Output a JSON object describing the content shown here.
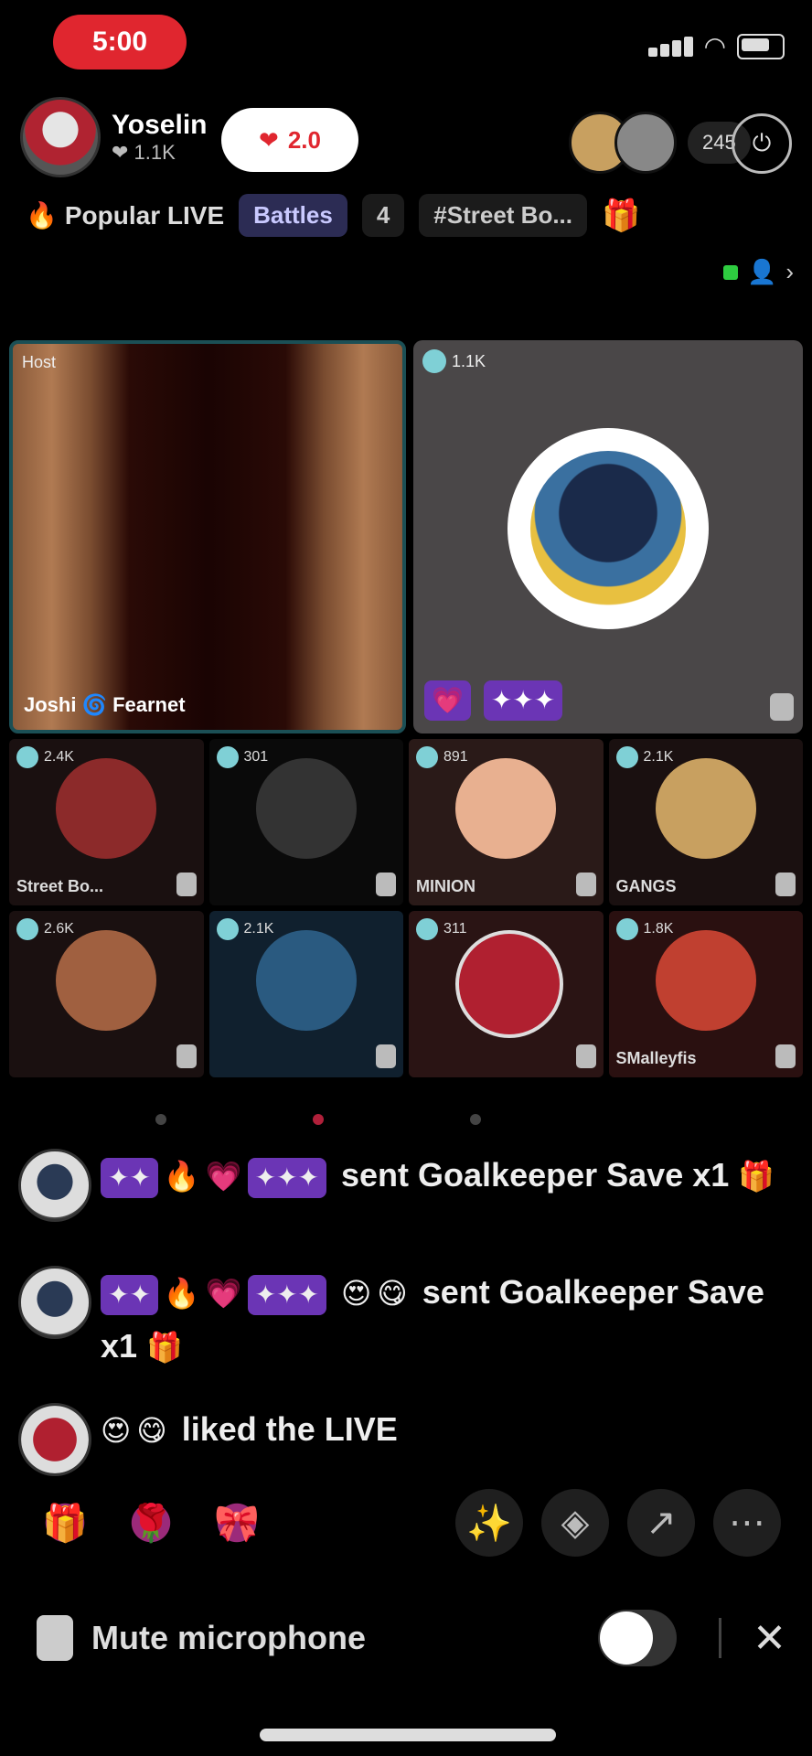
{
  "status_bar": {
    "time": "5:00"
  },
  "host": {
    "name": "Yoselin",
    "subtitle": "1.1K"
  },
  "like_pill": {
    "count": "2.0"
  },
  "viewers": {
    "count": "245"
  },
  "tags": {
    "popular": "Popular LIVE",
    "tag1": "Battles",
    "tag2": "4",
    "tag3": "#Street Bo..."
  },
  "big_tiles": [
    {
      "badge": "Host",
      "caption": "Joshi 🌀 Fearnet"
    },
    {
      "badge": "1.1K",
      "caption": ""
    }
  ],
  "grid": [
    {
      "count": "2.4K",
      "caption": "Street Bo...",
      "av": "#8c2a2a"
    },
    {
      "count": "301",
      "caption": "",
      "av": "#333"
    },
    {
      "count": "891",
      "caption": "MINION",
      "av": "#e8b090"
    },
    {
      "count": "2.1K",
      "caption": "GANGS",
      "av": "#c8a060"
    },
    {
      "count": "2.6K",
      "caption": "",
      "av": "#a06040"
    },
    {
      "count": "2.1K",
      "caption": "",
      "av": "#2a5a80"
    },
    {
      "count": "311",
      "caption": "",
      "av": "#b02030"
    },
    {
      "count": "1.8K",
      "caption": "SMalleyfis",
      "av": "#c04030"
    }
  ],
  "comments": [
    {
      "text": "sent Goalkeeper Save x1"
    },
    {
      "text": "sent Goalkeeper Save x1"
    },
    {
      "text": "liked the LIVE"
    }
  ],
  "bottom": {
    "mute_label": "Mute microphone",
    "close_icon": "✕"
  },
  "colors": {
    "accent": "#e0262f",
    "purple_badge": "#6b35b5"
  }
}
